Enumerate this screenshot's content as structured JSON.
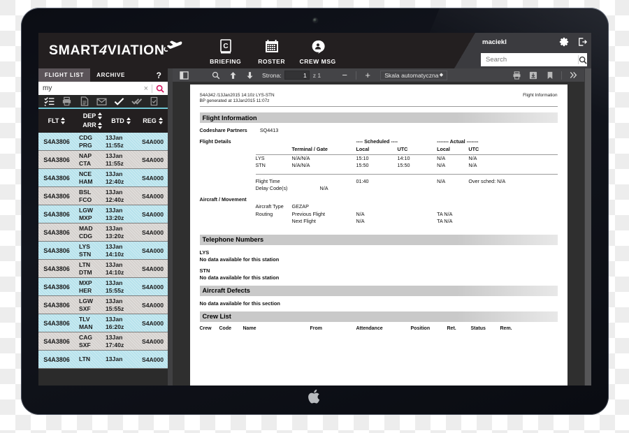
{
  "app": {
    "brand_text_1": "SMART",
    "brand_slash": "4",
    "brand_text_2": "VIATION",
    "nav": [
      {
        "label": "BRIEFING",
        "icon": "briefing-book-icon"
      },
      {
        "label": "ROSTER",
        "icon": "calendar-icon"
      },
      {
        "label": "CREW MSG",
        "icon": "crew-message-icon"
      }
    ],
    "user": "maciekl",
    "settings_icon": "gear-icon",
    "logout_icon": "logout-icon",
    "search": {
      "placeholder": "Search",
      "value": "",
      "icon": "search-icon"
    }
  },
  "left_panel": {
    "tabs": [
      {
        "label": "FLIGHT LIST",
        "active": true
      },
      {
        "label": "ARCHIVE",
        "active": false
      }
    ],
    "help_label": "?",
    "filter": {
      "value": "my",
      "clear_label": "×",
      "search_icon": "search-icon"
    },
    "strip_icons": [
      "checklist-icon",
      "printer-icon",
      "document-icon",
      "envelope-icon",
      "check-icon",
      "double-check-icon",
      "document-check-icon"
    ],
    "columns": [
      {
        "key": "FLT",
        "label": "FLT"
      },
      {
        "key": "DEPARR",
        "label_top": "DEP",
        "label_bottom": "ARR"
      },
      {
        "key": "BTD",
        "label": "BTD"
      },
      {
        "key": "REG",
        "label": "REG"
      }
    ],
    "rows": [
      {
        "flt": "S4A3806",
        "dep": "CDG",
        "arr": "PRG",
        "btd_date": "13Jan",
        "btd_time": "11:55z",
        "reg": "S4A000"
      },
      {
        "flt": "S4A3806",
        "dep": "NAP",
        "arr": "CTA",
        "btd_date": "13Jan",
        "btd_time": "11:55z",
        "reg": "S4A000"
      },
      {
        "flt": "S4A3806",
        "dep": "NCE",
        "arr": "HAM",
        "btd_date": "13Jan",
        "btd_time": "12:40z",
        "reg": "S4A000"
      },
      {
        "flt": "S4A3806",
        "dep": "BSL",
        "arr": "FCO",
        "btd_date": "13Jan",
        "btd_time": "12:40z",
        "reg": "S4A000"
      },
      {
        "flt": "S4A3806",
        "dep": "LGW",
        "arr": "MXP",
        "btd_date": "13Jan",
        "btd_time": "13:20z",
        "reg": "S4A000"
      },
      {
        "flt": "S4A3806",
        "dep": "MAD",
        "arr": "CDG",
        "btd_date": "13Jan",
        "btd_time": "13:20z",
        "reg": "S4A000"
      },
      {
        "flt": "S4A3806",
        "dep": "LYS",
        "arr": "STN",
        "btd_date": "13Jan",
        "btd_time": "14:10z",
        "reg": "S4A000"
      },
      {
        "flt": "S4A3806",
        "dep": "LTN",
        "arr": "DTM",
        "btd_date": "13Jan",
        "btd_time": "14:10z",
        "reg": "S4A000"
      },
      {
        "flt": "S4A3806",
        "dep": "MXP",
        "arr": "HER",
        "btd_date": "13Jan",
        "btd_time": "15:55z",
        "reg": "S4A000"
      },
      {
        "flt": "S4A3806",
        "dep": "LGW",
        "arr": "SXF",
        "btd_date": "13Jan",
        "btd_time": "15:55z",
        "reg": "S4A000"
      },
      {
        "flt": "S4A3806",
        "dep": "TLV",
        "arr": "MAN",
        "btd_date": "13Jan",
        "btd_time": "16:20z",
        "reg": "S4A000"
      },
      {
        "flt": "S4A3806",
        "dep": "CAG",
        "arr": "SXF",
        "btd_date": "13Jan",
        "btd_time": "17:40z",
        "reg": "S4A000"
      },
      {
        "flt": "S4A3806",
        "dep": "LTN",
        "arr": "",
        "btd_date": "13Jan",
        "btd_time": "",
        "reg": "S4A000"
      }
    ]
  },
  "pdf_toolbar": {
    "sidebar_icon": "sidebar-toggle-icon",
    "find_icon": "search-icon",
    "prev_icon": "arrow-up-icon",
    "next_icon": "arrow-down-icon",
    "page_label": "Strona:",
    "page_value": "1",
    "page_of": "z 1",
    "zoom_out_label": "−",
    "zoom_in_label": "+",
    "scale_label": "Skala automatyczna",
    "print_icon": "printer-icon",
    "download_icon": "download-icon",
    "bookmark_icon": "bookmark-icon",
    "more_icon": "chevron-double-right-icon"
  },
  "document": {
    "header_line1": "S4A342  /13Jan2015 14:10z LYS-STN",
    "header_line2": "BP generated at 13Jan2015 11:07z",
    "header_right": "Flight Information",
    "sections": {
      "flight_information": "Flight Information",
      "telephone_numbers": "Telephone Numbers",
      "aircraft_defects": "Aircraft Defects",
      "crew_list": "Crew List"
    },
    "codeshare_label": "Codeshare Partners",
    "codeshare_value": "SQ4413",
    "flight_details_label": "Flight Details",
    "group_scheduled": "---- Scheduled ----",
    "group_actual": "------- Actual -------",
    "col_terminal_gate": "Terminal / Gate",
    "col_local": "Local",
    "col_utc": "UTC",
    "col_local2": "Local",
    "col_utc2": "UTC",
    "stations": [
      {
        "code": "LYS",
        "terminal_gate": "N/A/N/A",
        "sched_local": "15:10",
        "sched_utc": "14:10",
        "act_local": "N/A",
        "act_utc": "N/A"
      },
      {
        "code": "STN",
        "terminal_gate": "N/A/N/A",
        "sched_local": "15:50",
        "sched_utc": "15:50",
        "act_local": "N/A",
        "act_utc": "N/A"
      }
    ],
    "flight_time_label": "Flight Time",
    "flight_time_value": "01:40",
    "flight_time_actual": "N/A",
    "over_sched": "Over sched: N/A",
    "delay_codes_label": "Delay Code(s)",
    "delay_codes_value": "N/A",
    "aircraft_movement_label": "Aircraft / Movement",
    "aircraft_type_label": "Aircraft Type",
    "aircraft_type_value": "GEZAP",
    "routing_label": "Routing",
    "previous_flight_label": "Previous Flight",
    "previous_flight_value": "N/A",
    "previous_flight_ta": "TA  N/A",
    "next_flight_label": "Next Flight",
    "next_flight_value": "N/A",
    "next_flight_ta": "TA  N/A",
    "phone_stations": [
      {
        "code": "LYS",
        "message": "No data available for this station"
      },
      {
        "code": "STN",
        "message": "No data available for this station"
      }
    ],
    "defects_message": "No data available for this section",
    "crew_columns": [
      "Crew",
      "Code",
      "Name",
      "From",
      "Attendance",
      "Position",
      "Ret.",
      "Status",
      "Rem."
    ]
  }
}
